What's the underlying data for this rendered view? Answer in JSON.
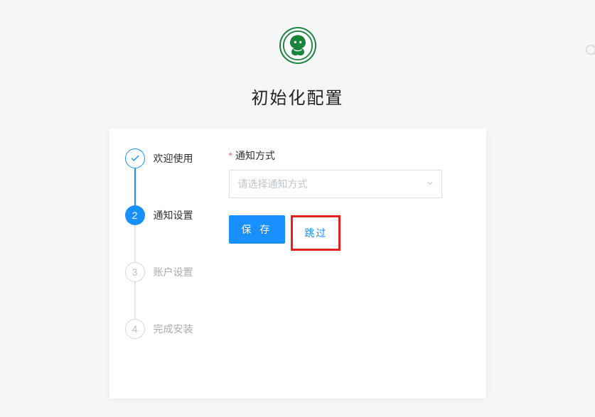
{
  "page": {
    "title": "初始化配置"
  },
  "steps": [
    {
      "label": "欢迎使用",
      "iconText": ""
    },
    {
      "label": "通知设置",
      "iconText": "2"
    },
    {
      "label": "账户设置",
      "iconText": "3"
    },
    {
      "label": "完成安装",
      "iconText": "4"
    }
  ],
  "form": {
    "field_label": "通知方式",
    "select_placeholder": "请选择通知方式"
  },
  "buttons": {
    "save": "保 存",
    "skip": "跳过"
  }
}
